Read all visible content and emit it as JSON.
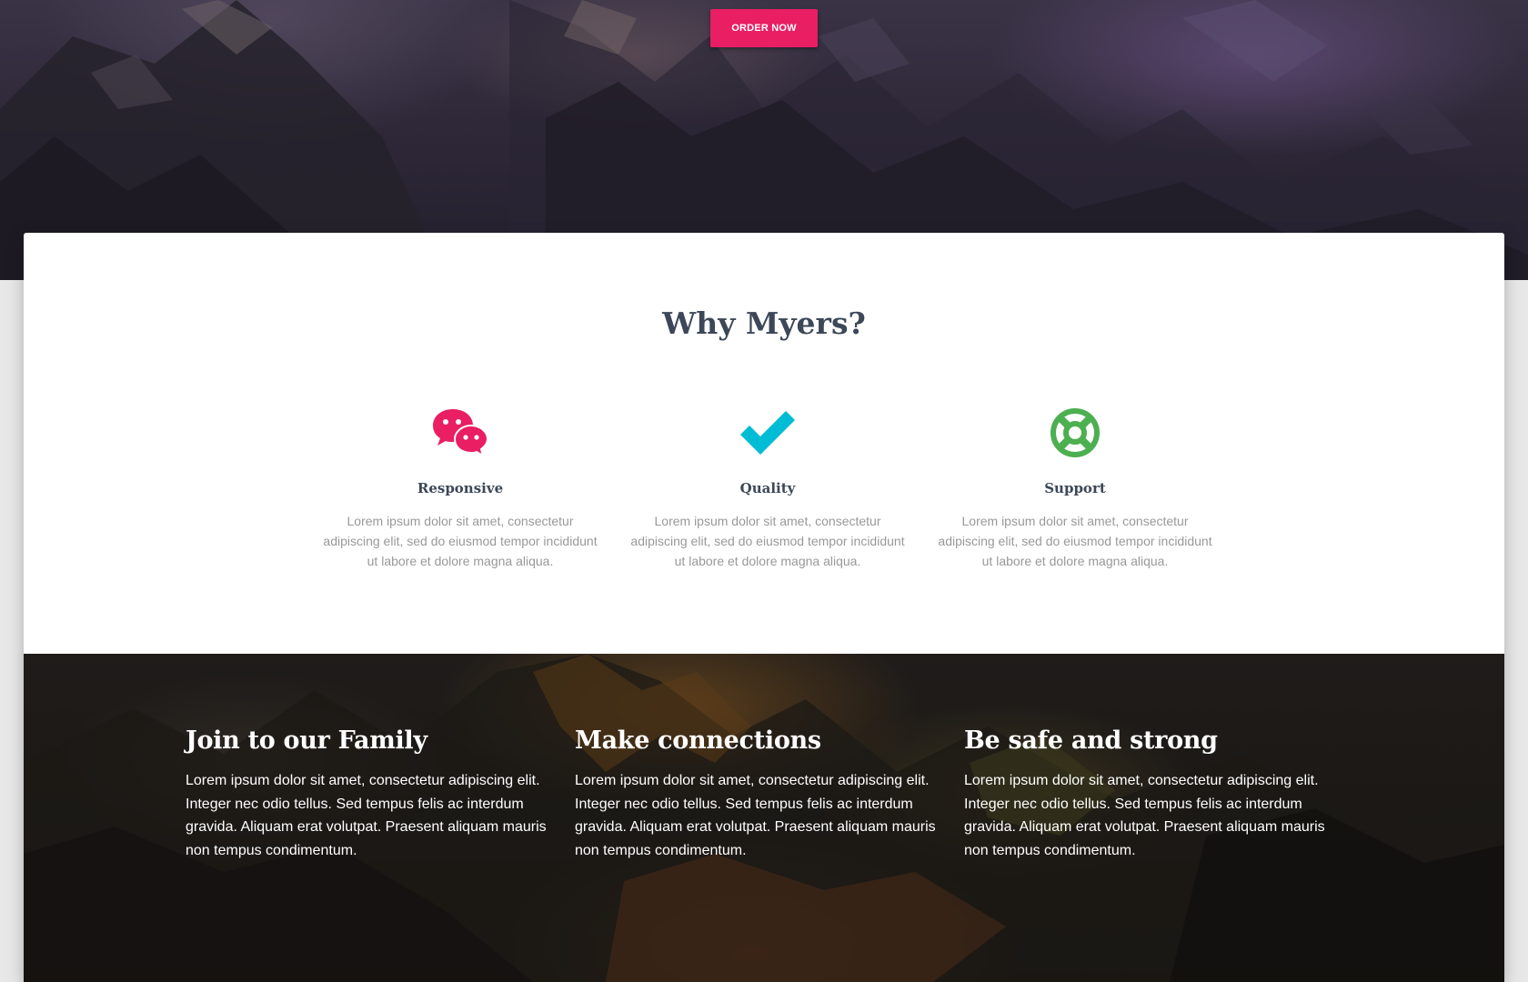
{
  "hero": {
    "order_button": "ORDER NOW"
  },
  "why": {
    "title": "Why Myers?",
    "features": [
      {
        "icon": "chat-bubbles-icon",
        "color": "#e91e63",
        "title": "Responsive",
        "text": "Lorem ipsum dolor sit amet, consectetur adipiscing elit, sed do eiusmod tempor incididunt ut labore et dolore magna aliqua."
      },
      {
        "icon": "checkmark-icon",
        "color": "#00bcd4",
        "title": "Quality",
        "text": "Lorem ipsum dolor sit amet, consectetur adipiscing elit, sed do eiusmod tempor incididunt ut labore et dolore magna aliqua."
      },
      {
        "icon": "lifebuoy-icon",
        "color": "#4caf50",
        "title": "Support",
        "text": "Lorem ipsum dolor sit amet, consectetur adipiscing elit, sed do eiusmod tempor incididunt ut labore et dolore magna aliqua."
      }
    ]
  },
  "columns": [
    {
      "title": "Join to our Family",
      "text": "Lorem ipsum dolor sit amet, consectetur adipiscing elit. Integer nec odio tellus. Sed tempus felis ac interdum gravida. Aliquam erat volutpat. Praesent aliquam mauris non tempus condimentum."
    },
    {
      "title": "Make connections",
      "text": "Lorem ipsum dolor sit amet, consectetur adipiscing elit. Integer nec odio tellus. Sed tempus felis ac interdum gravida. Aliquam erat volutpat. Praesent aliquam mauris non tempus condimentum."
    },
    {
      "title": "Be safe and strong",
      "text": "Lorem ipsum dolor sit amet, consectetur adipiscing elit. Integer nec odio tellus. Sed tempus felis ac interdum gravida. Aliquam erat volutpat. Praesent aliquam mauris non tempus condimentum."
    }
  ]
}
